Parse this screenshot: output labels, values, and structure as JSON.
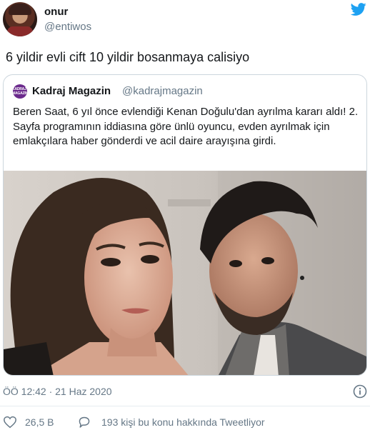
{
  "author": {
    "name": "onur",
    "handle": "@entiwos",
    "avatar_icon": "user-avatar"
  },
  "brand_icon": "twitter-bird-icon",
  "brand_color": "#1da1f2",
  "tweet": {
    "text": "6 yildir evli cift 10 yildir bosanmaya calisiyo"
  },
  "quoted": {
    "name": "Kadraj Magazin",
    "handle": "@kadrajmagazin",
    "avatar_text": "KADRAJ MAGAZIN",
    "body": "Beren Saat, 6 yıl önce evlendiği Kenan Doğulu'dan ayrılma kararı aldı! 2. Sayfa programının iddiasına göre ünlü oyuncu, evden ayrılmak için emlakçılara haber gönderdi ve acil daire arayışına girdi.",
    "image_icon": "photo-of-couple"
  },
  "meta": {
    "timestamp": "ÖÖ 12:42 · 21 Haz 2020"
  },
  "actions": {
    "likes": "26,5 B",
    "talking": "193 kişi bu konu hakkında Tweetliyor"
  }
}
